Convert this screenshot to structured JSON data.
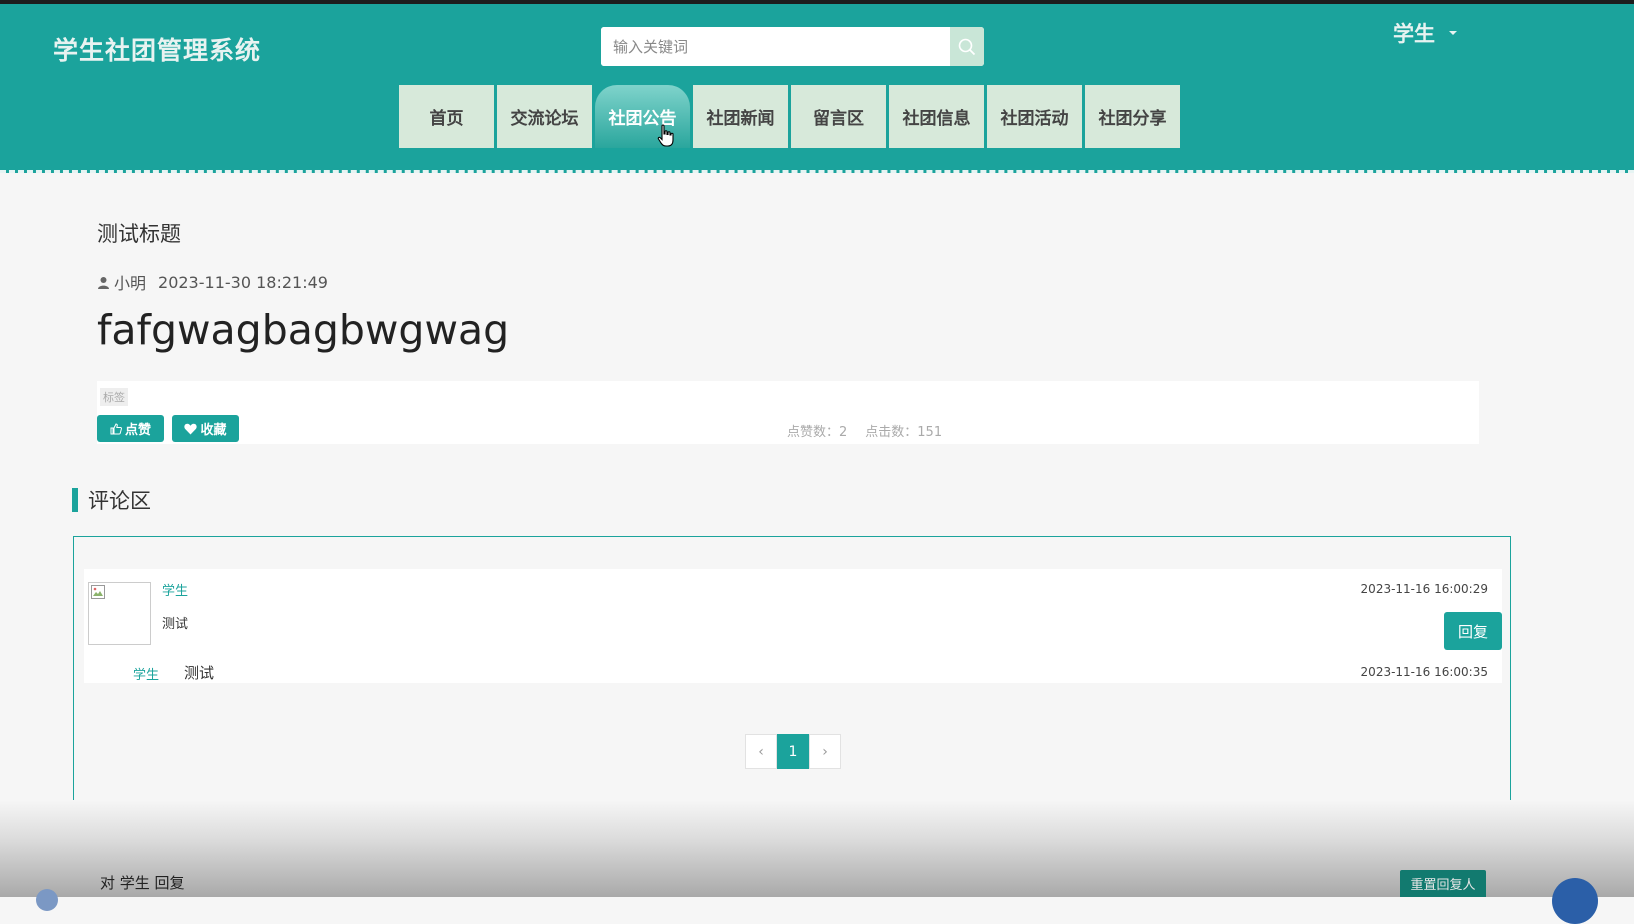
{
  "header": {
    "site_title": "学生社团管理系统",
    "search_placeholder": "输入关键词",
    "user": "学生"
  },
  "nav": [
    {
      "label": "首页",
      "active": false
    },
    {
      "label": "交流论坛",
      "active": false
    },
    {
      "label": "社团公告",
      "active": true
    },
    {
      "label": "社团新闻",
      "active": false
    },
    {
      "label": "留言区",
      "active": false
    },
    {
      "label": "社团信息",
      "active": false
    },
    {
      "label": "社团活动",
      "active": false
    },
    {
      "label": "社团分享",
      "active": false
    }
  ],
  "post": {
    "title": "测试标题",
    "author": "小明",
    "date": "2023-11-30 18:21:49",
    "content": "fafgwagbagbwgwag",
    "tag": "标签",
    "like_label": "点赞",
    "fav_label": "收藏",
    "likes_text": "点赞数：2",
    "clicks_text": "点击数：151"
  },
  "comments_section": {
    "title": "评论区",
    "comment": {
      "user": "学生",
      "text": "测试",
      "time": "2023-11-16 16:00:29",
      "reply_label": "回复",
      "reply": {
        "user": "学生",
        "text": "测试",
        "time": "2023-11-16 16:00:35"
      }
    },
    "pagination": {
      "prev": "‹",
      "current": "1",
      "next": "›"
    }
  },
  "reply_form": {
    "reply_to_text": "对 学生 回复",
    "reset_label": "重置回复人"
  },
  "colors": {
    "primary": "#1ba39c",
    "nav_bg": "#d7e9da"
  }
}
